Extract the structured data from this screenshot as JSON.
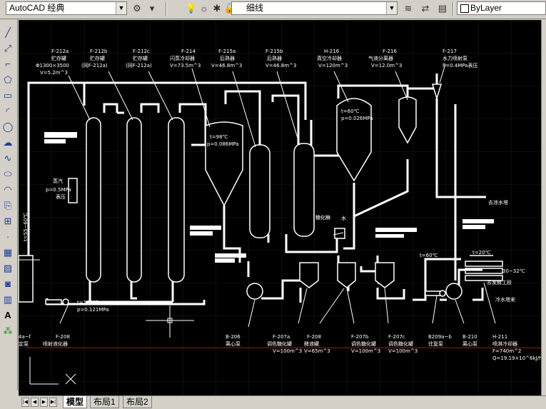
{
  "toolbar": {
    "workspace": "AutoCAD 经典",
    "layer": "细线",
    "color": "ByLayer"
  },
  "tabs": [
    {
      "label": "模型"
    },
    {
      "label": "布局1"
    },
    {
      "label": "布局2"
    }
  ],
  "drawing": {
    "top_labels": [
      {
        "tag": "F-212a",
        "lines": [
          "F-212a",
          "贮存罐",
          "Φ1300×3500",
          "V=5.2m^3"
        ]
      },
      {
        "tag": "F-212b",
        "lines": [
          "F-212b",
          "贮存罐",
          "(同F-212a)"
        ]
      },
      {
        "tag": "F-212c",
        "lines": [
          "F-212c",
          "贮存罐",
          "(同F-212a)"
        ]
      },
      {
        "tag": "F-214",
        "lines": [
          "F-214",
          "闪蒸冷却器",
          "V=73.5m^3"
        ]
      },
      {
        "tag": "F-215a",
        "lines": [
          "F-215a",
          "后熟器",
          "V=46.8m^3"
        ]
      },
      {
        "tag": "F-215b",
        "lines": [
          "F-215b",
          "后熟器",
          "V=46.8m^3"
        ]
      },
      {
        "tag": "H-216",
        "lines": [
          "H-216",
          "真空冷却器",
          "V=120m^3"
        ]
      },
      {
        "tag": "F-216",
        "lines": [
          "F-216",
          "气液分离器",
          "V=12.0m^3"
        ]
      },
      {
        "tag": "F-217",
        "lines": [
          "F-217",
          "水力喷射泵",
          "P=0.4MPa表压"
        ]
      }
    ],
    "bottom_labels": [
      {
        "lines": [
          "4a~f",
          "定泵"
        ]
      },
      {
        "lines": [
          "F-208",
          "喷射液化器"
        ]
      },
      {
        "lines": [
          "B-206",
          "离心泵"
        ]
      },
      {
        "lines": [
          "F-207a",
          "调色糖化罐",
          "V=100m^3"
        ]
      },
      {
        "lines": [
          "F-208",
          "酵液罐",
          "V=65m^3"
        ]
      },
      {
        "lines": [
          "F-207b",
          "调色糖化罐",
          "V=100m^3"
        ]
      },
      {
        "lines": [
          "F-207c",
          "调色糖化罐",
          "V=100m^3"
        ]
      },
      {
        "lines": [
          "B209a~b",
          "往复泵"
        ]
      },
      {
        "lines": [
          "B-210",
          "离心泵"
        ]
      },
      {
        "lines": [
          "H-211",
          "喷淋冷却器",
          "F=740m^2",
          "Q=19.19×10^6kJ/h"
        ]
      }
    ],
    "annotations": {
      "steam_left": [
        "蒸汽",
        "p=0.5MPa",
        "表压"
      ],
      "temp_vertical": "t=55~60℃",
      "bottom_temp": [
        "t=105℃",
        "p=0.121MPa"
      ],
      "f214_cond": [
        "t=98℃",
        "p=0.086MPa"
      ],
      "h216_cond": [
        "t=60℃",
        "p=0.026MPa"
      ],
      "enzyme": "糖化酶",
      "water": "水",
      "t60": "t=60℃",
      "t20": "t=20℃",
      "t30": "30~32℃",
      "to_fermenter": "去发酵工段",
      "cooling_water_out": "去凉水塔",
      "cooling_water_in": "冷水塔来",
      "cooling_water_out2": "去凉水塔"
    }
  }
}
